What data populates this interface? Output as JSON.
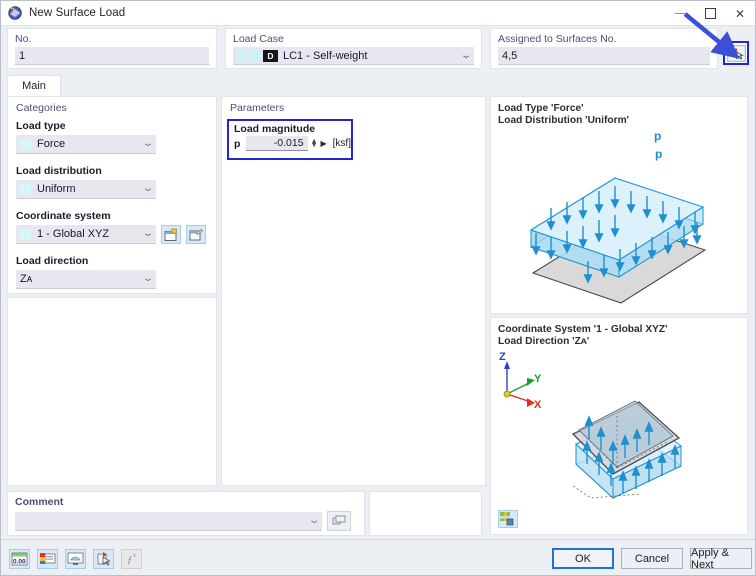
{
  "window": {
    "title": "New Surface Load",
    "icon": "surface-load-icon",
    "minimize": "–",
    "maximize": "□",
    "close": "✕"
  },
  "header": {
    "no": {
      "label": "No.",
      "value": "1"
    },
    "load_case": {
      "label": "Load Case",
      "value": "LC1 - Self-weight",
      "badge": "D",
      "caret": "⌄"
    },
    "assigned": {
      "label": "Assigned to Surfaces No.",
      "value": "4,5"
    },
    "assign_button": "select-surfaces-button"
  },
  "tabs": [
    {
      "label": "Main",
      "active": true
    }
  ],
  "categories": {
    "title": "Categories",
    "fields": [
      {
        "label": "Load type",
        "value": "Force",
        "caret": "⌄"
      },
      {
        "label": "Load distribution",
        "value": "Uniform",
        "caret": "⌄"
      },
      {
        "label": "Coordinate system",
        "value": "1 - Global XYZ",
        "caret": "⌄"
      },
      {
        "label": "Load direction",
        "value": "Zᴀ",
        "caret": "⌄"
      }
    ],
    "new_cs_button": "new-coordinate-system-button",
    "edit_cs_button": "edit-coordinate-system-button"
  },
  "parameters": {
    "title": "Parameters",
    "magnitude": {
      "label": "Load magnitude",
      "symbol": "p",
      "value": "-0.015",
      "unit": "[ksf]",
      "spin_up": "▲",
      "spin_down": "▼",
      "play": "▶"
    }
  },
  "preview_top": {
    "line1": "Load Type 'Force'",
    "line2": "Load Distribution 'Uniform'",
    "load_symbol": "p"
  },
  "preview_bottom": {
    "line1": "Coordinate System '1 - Global XYZ'",
    "line2": "Load Direction 'Zᴀ'",
    "axis_z": "Z",
    "axis_y": "Y",
    "axis_x": "X",
    "corner_button": "preview-settings-button"
  },
  "comment": {
    "label": "Comment",
    "value": "",
    "placeholder": "",
    "caret": "⌄",
    "button": "comment-library-button"
  },
  "bottom_toolbar": [
    {
      "name": "units-button",
      "label": "0.00"
    },
    {
      "name": "display-properties-button",
      "label": ""
    },
    {
      "name": "graphic-button",
      "label": ""
    },
    {
      "name": "info-button",
      "label": ""
    },
    {
      "name": "formula-button",
      "label": "ƒ",
      "disabled": true
    }
  ],
  "buttons": {
    "ok": "OK",
    "cancel": "Cancel",
    "apply_next": "Apply & Next"
  },
  "colors": {
    "accent_blue": "#2323d8",
    "arrow_blue": "#3b4fd8",
    "load_cyan": "#2196d6",
    "field_bg": "#e7e7f0",
    "group_label": "#4a4f7a",
    "axis_z": "#2b3fd0",
    "axis_y": "#18a02a",
    "axis_x": "#e03020"
  }
}
